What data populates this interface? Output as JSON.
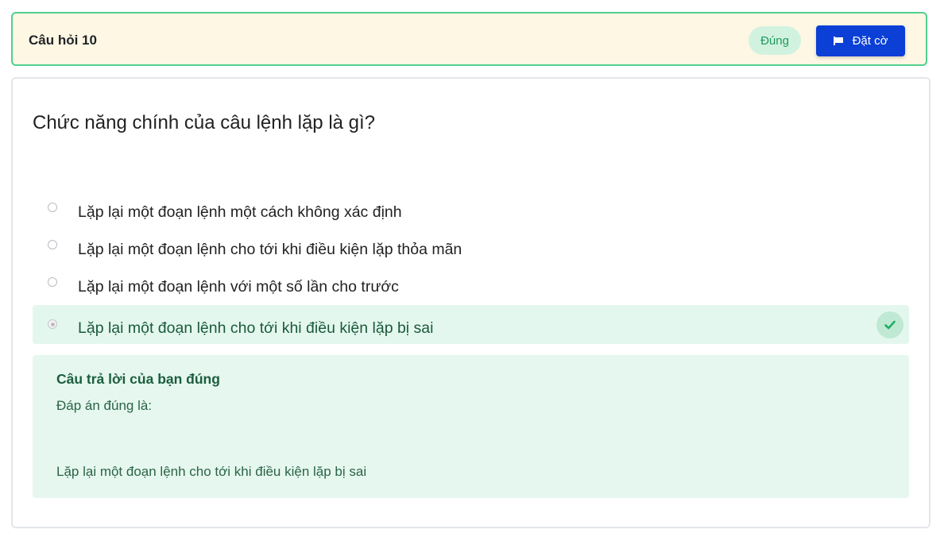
{
  "header": {
    "title": "Câu hỏi 10",
    "status": "Đúng",
    "flag_label": "Đặt cờ",
    "accent_color": "#4fd08f",
    "button_color": "#0b3fd6"
  },
  "question": {
    "text": "Chức năng chính của câu lệnh lặp là gì?",
    "options": [
      {
        "label": "Lặp lại một đoạn lệnh một cách không xác định",
        "selected": false
      },
      {
        "label": "Lặp lại một đoạn lệnh cho tới khi điều kiện lặp thỏa mãn",
        "selected": false
      },
      {
        "label": "Lặp lại một đoạn lệnh với một số lần cho trước",
        "selected": false
      },
      {
        "label": "Lặp lại một đoạn lệnh cho tới khi điều kiện lặp bị sai",
        "selected": true,
        "correct": true
      }
    ]
  },
  "feedback": {
    "title": "Câu trả lời của bạn đúng",
    "subtitle": "Đáp án đúng là:",
    "answer": "Lặp lại một đoạn lệnh cho tới khi điều kiện lặp bị sai"
  },
  "icons": {
    "flag": "flag-icon",
    "check": "check-icon"
  }
}
